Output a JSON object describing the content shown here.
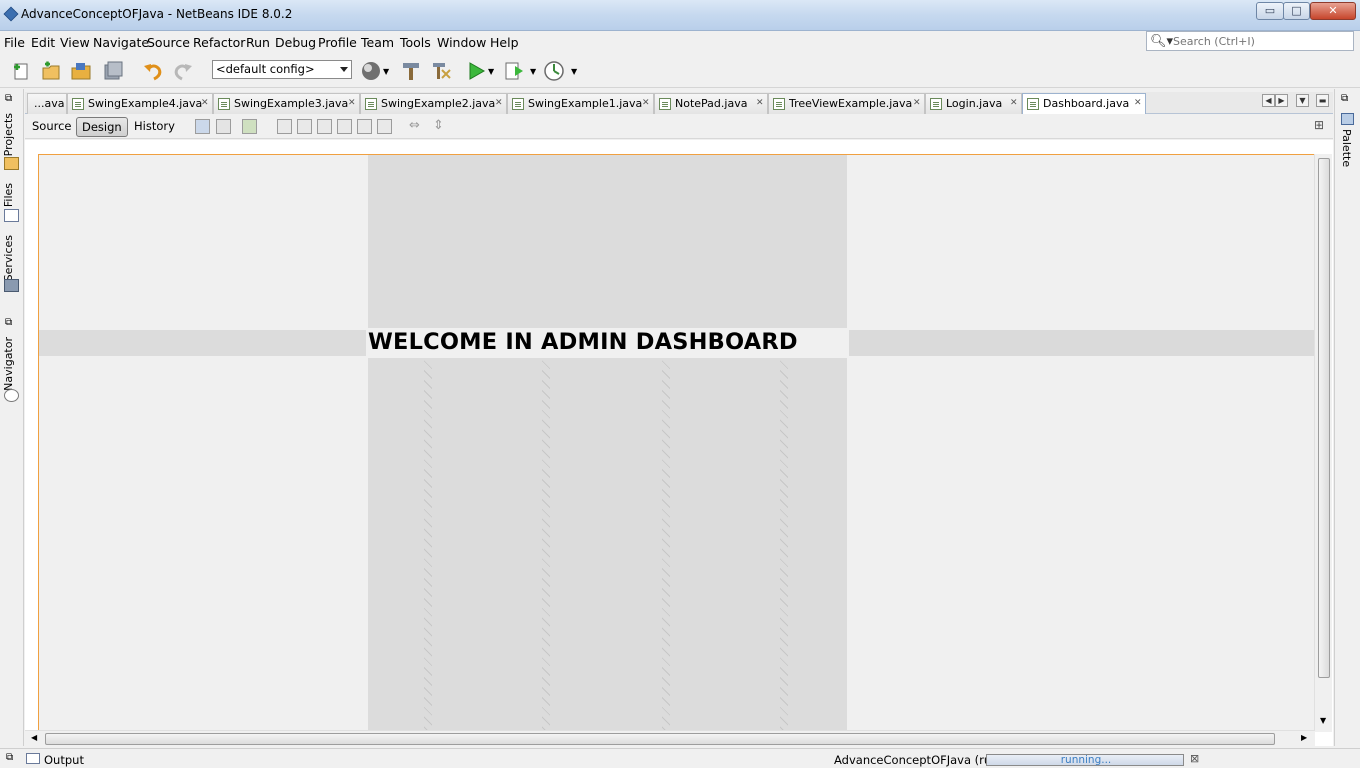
{
  "window": {
    "title": "AdvanceConceptOFJava - NetBeans IDE 8.0.2",
    "buttons": {
      "minimize": "▭",
      "maximize": "□",
      "close": "✕"
    }
  },
  "menu": {
    "items": [
      "File",
      "Edit",
      "View",
      "Navigate",
      "Source",
      "Refactor",
      "Run",
      "Debug",
      "Profile",
      "Team",
      "Tools",
      "Window",
      "Help"
    ]
  },
  "search": {
    "placeholder": "Search (Ctrl+I)"
  },
  "toolbar": {
    "config": "<default config>"
  },
  "left_sidebar": {
    "tabs": [
      "Projects",
      "Files",
      "Services",
      "Navigator"
    ]
  },
  "right_sidebar": {
    "tabs": [
      "Palette"
    ]
  },
  "editor_tabs": [
    {
      "label": "...ava"
    },
    {
      "label": "SwingExample4.java"
    },
    {
      "label": "SwingExample3.java"
    },
    {
      "label": "SwingExample2.java"
    },
    {
      "label": "SwingExample1.java"
    },
    {
      "label": "NotePad.java"
    },
    {
      "label": "TreeViewExample.java"
    },
    {
      "label": "Login.java"
    },
    {
      "label": "Dashboard.java",
      "active": true
    }
  ],
  "editor_modes": {
    "source": "Source",
    "design": "Design",
    "history": "History",
    "active": "Design"
  },
  "design_form": {
    "welcome_label": "WELCOME IN ADMIN DASHBOARD"
  },
  "statusbar": {
    "output": "Output",
    "run_target": "AdvanceConceptOFJava (run)",
    "progress_text": "running..."
  },
  "colors": {
    "form_border": "#f0a040",
    "gray_panel": "#dcdcdc",
    "progress_text": "#3c7fc4"
  }
}
